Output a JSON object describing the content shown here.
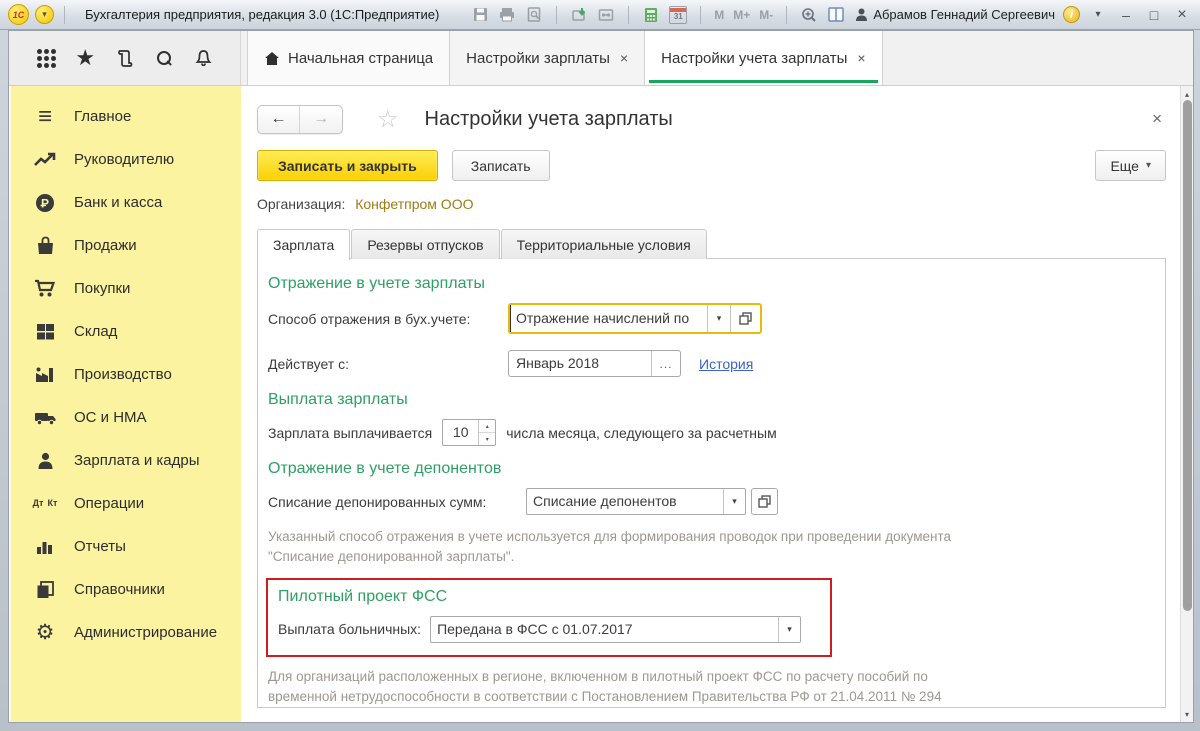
{
  "titlebar": {
    "app_title": "Бухгалтерия предприятия, редакция 3.0  (1С:Предприятие)",
    "memory_buttons": [
      "M",
      "M+",
      "M-"
    ],
    "user_name": "Абрамов Геннадий Сергеевич"
  },
  "glyphs": {
    "logo": "1С",
    "caret": "▾",
    "dropdown": "▾",
    "up": "▴",
    "down": "▾",
    "back": "←",
    "forward": "→",
    "star_outline": "☆",
    "star": "★",
    "menu": "≡",
    "gear": "⚙",
    "info": "i",
    "calendar_day": "31",
    "minimize": "–",
    "maximize": "□",
    "close": "×",
    "ellipsis": "...",
    "dt": "Дт",
    "kt": "Кт"
  },
  "main_tabs": [
    {
      "label": "Начальная страница"
    },
    {
      "label": "Настройки зарплаты"
    },
    {
      "label": "Настройки учета зарплаты"
    }
  ],
  "sidebar": {
    "items": [
      {
        "label": "Главное"
      },
      {
        "label": "Руководителю"
      },
      {
        "label": "Банк и касса"
      },
      {
        "label": "Продажи"
      },
      {
        "label": "Покупки"
      },
      {
        "label": "Склад"
      },
      {
        "label": "Производство"
      },
      {
        "label": "ОС и НМА"
      },
      {
        "label": "Зарплата и кадры"
      },
      {
        "label": "Операции"
      },
      {
        "label": "Отчеты"
      },
      {
        "label": "Справочники"
      },
      {
        "label": "Администрирование"
      }
    ]
  },
  "page": {
    "title": "Настройки учета зарплаты",
    "buttons": {
      "save_close": "Записать и закрыть",
      "save": "Записать",
      "more": "Еще"
    },
    "organization_label": "Организация:",
    "organization_value": "Конфетпром ООО",
    "form_tabs": [
      {
        "label": "Зарплата"
      },
      {
        "label": "Резервы отпусков"
      },
      {
        "label": "Территориальные условия"
      }
    ]
  },
  "form": {
    "section1_title": "Отражение в учете зарплаты",
    "reflect_label": "Способ отражения в бух.учете:",
    "reflect_value": "Отражение начислений по",
    "valid_from_label": "Действует с:",
    "valid_from_value": "Январь 2018",
    "history_link": "История",
    "section2_title": "Выплата зарплаты",
    "pay_prefix": "Зарплата выплачивается",
    "pay_day": "10",
    "pay_suffix": "числа месяца, следующего за расчетным",
    "section3_title": "Отражение в учете депонентов",
    "depon_label": "Списание депонированных сумм:",
    "depon_value": "Списание депонентов",
    "depon_hint": "Указанный способ отражения в учете используется для формирования проводок при проведении документа \"Списание депонированной зарплаты\".",
    "fss_section_title": "Пилотный проект ФСС",
    "fss_label": "Выплата больничных:",
    "fss_value": "Передана в ФСС с 01.07.2017",
    "fss_hint": "Для организаций расположенных в регионе, включенном в пилотный проект ФСС по расчету пособий по временной нетрудоспособности в соответствии с Постановлением Правительства РФ от 21.04.2011 № 294"
  },
  "colors": {
    "accent_green": "#17a75c",
    "section_green": "#2da164",
    "highlight_red": "#cf1d1d",
    "sidebar_yellow": "#fbf3a0",
    "button_yellow": "#fbd004",
    "focus_yellow": "#e9b90c",
    "link_blue": "#3a63c8",
    "org_link_brown": "#9d7c13",
    "hint_gray": "#9d9890"
  }
}
